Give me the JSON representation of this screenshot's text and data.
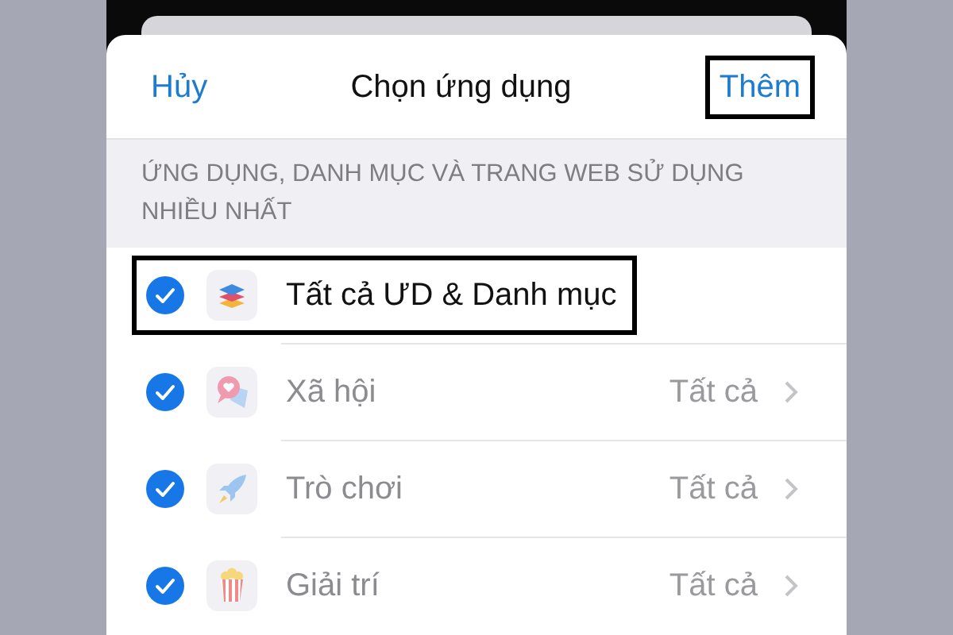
{
  "header": {
    "cancel": "Hủy",
    "title": "Chọn ứng dụng",
    "add": {
      "label": "Thêm",
      "highlighted": true
    }
  },
  "section": {
    "title": "ỨNG DỤNG, DANH MỤC VÀ TRANG WEB SỬ DỤNG NHIỀU NHẤT"
  },
  "rows": [
    {
      "kind": "all",
      "label": "Tất cả ƯD & Danh mục",
      "checked": true,
      "dimmed": false,
      "highlighted": true
    },
    {
      "kind": "category",
      "label": "Xã hội",
      "detail": "Tất cả",
      "checked": true,
      "dimmed": true,
      "highlighted": false
    },
    {
      "kind": "category",
      "label": "Trò chơi",
      "detail": "Tất cả",
      "checked": true,
      "dimmed": true,
      "highlighted": false
    },
    {
      "kind": "category",
      "label": "Giải trí",
      "detail": "Tất cả",
      "checked": true,
      "dimmed": true,
      "highlighted": false
    }
  ]
}
